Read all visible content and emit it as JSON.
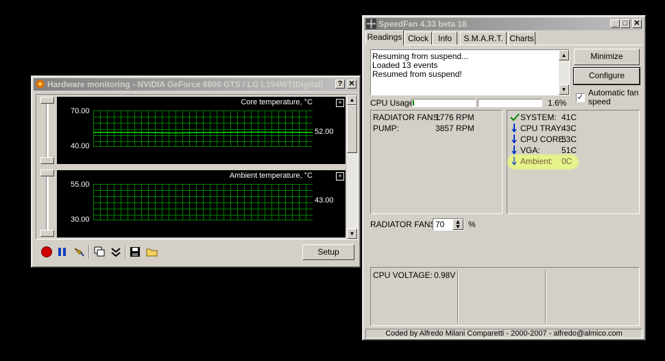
{
  "hwmon": {
    "title": "Hardware monitoring - NVIDIA GeForce 8800 GTS / LG L194WT(Digital)",
    "help_label": "?",
    "close_label": "✕",
    "graphs": [
      {
        "name": "Core temperature, °C",
        "max": "70.00",
        "min": "40.00",
        "current": "52.00"
      },
      {
        "name": "Ambient temperature, °C",
        "max": "55.00",
        "min": "30.00",
        "current": "43.00"
      }
    ],
    "setup_label": "Setup"
  },
  "speedfan": {
    "title": "SpeedFan 4.33 beta 18",
    "tabs": [
      "Readings",
      "Clock",
      "Info",
      "S.M.A.R.T.",
      "Charts"
    ],
    "log": [
      "Resuming from suspend...",
      "Loaded 13 events",
      "Resumed from suspend!"
    ],
    "minimize_label": "Minimize",
    "configure_label": "Configure",
    "auto_fan_label": "Automatic fan speed",
    "cpu_usage_label": "CPU Usage",
    "cpu_usage_value": "1.6%",
    "fans": [
      {
        "label": "RADIATOR FANS:",
        "value": "1776 RPM"
      },
      {
        "label": "PUMP:",
        "value": "3857 RPM"
      }
    ],
    "temps": [
      {
        "label": "SYSTEM:",
        "value": "41C",
        "icon": "check-icon"
      },
      {
        "label": "CPU TRAY:",
        "value": "43C",
        "icon": "arrow-down-icon"
      },
      {
        "label": "CPU CORE:",
        "value": "53C",
        "icon": "arrow-down-icon"
      },
      {
        "label": "VGA:",
        "value": "51C",
        "icon": "arrow-down-icon"
      },
      {
        "label": "Ambient:",
        "value": "0C",
        "icon": "arrow-down-icon"
      }
    ],
    "speed_label": "RADIATOR FANS:",
    "speed_value": "70",
    "speed_unit": "%",
    "voltage_label": "CPU VOLTAGE:",
    "voltage_value": "0.98V",
    "footer": "Coded by Alfredo Milani Comparetti - 2000-2007 - alfredo@almico.com"
  },
  "colors": {
    "graph_line": "#00c000",
    "highlight": "#e6f28a",
    "title_gradient_start": "#808080"
  }
}
